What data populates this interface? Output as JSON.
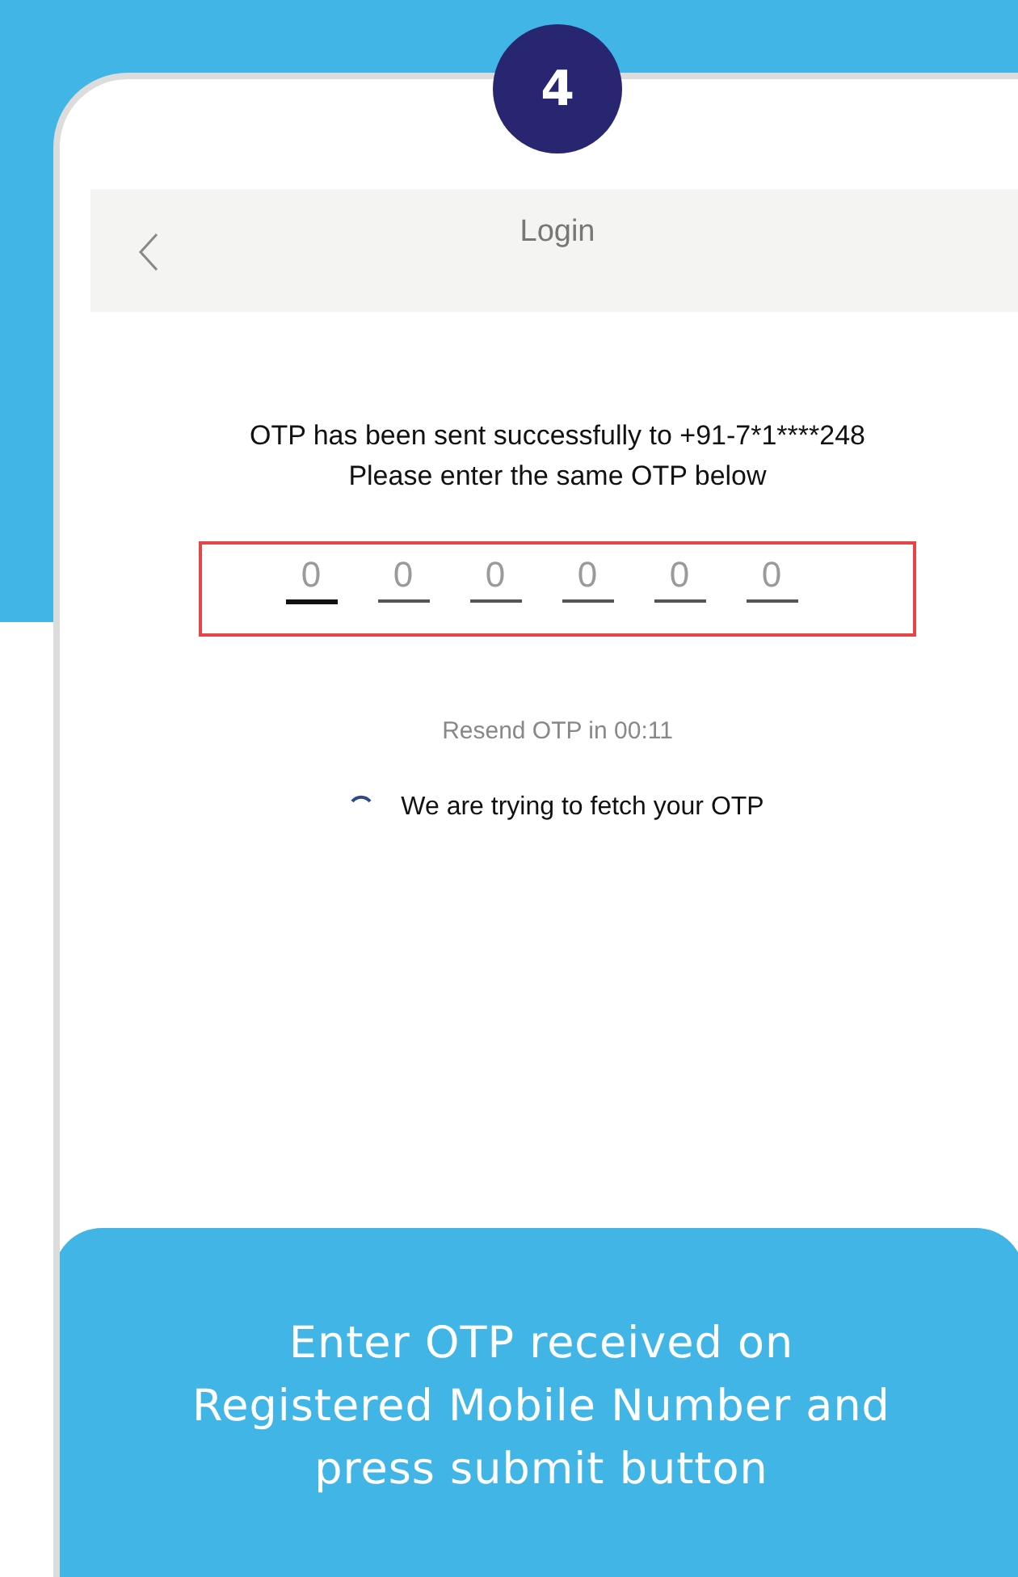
{
  "step_badge": "4",
  "header": {
    "title": "Login"
  },
  "message": [
    "OTP has been sent successfully to +91-7*1****248",
    "Please enter the same OTP below"
  ],
  "otp_fields": [
    {
      "placeholder": "0",
      "focused": true
    },
    {
      "placeholder": "0",
      "focused": false
    },
    {
      "placeholder": "0",
      "focused": false
    },
    {
      "placeholder": "0",
      "focused": false
    },
    {
      "placeholder": "0",
      "focused": false
    },
    {
      "placeholder": "0",
      "focused": false
    }
  ],
  "resend_timer": "Resend OTP in 00:11",
  "fetch_status": "We are trying to fetch your OTP",
  "caption": "Enter OTP received on Registered Mobile Number and press submit button"
}
